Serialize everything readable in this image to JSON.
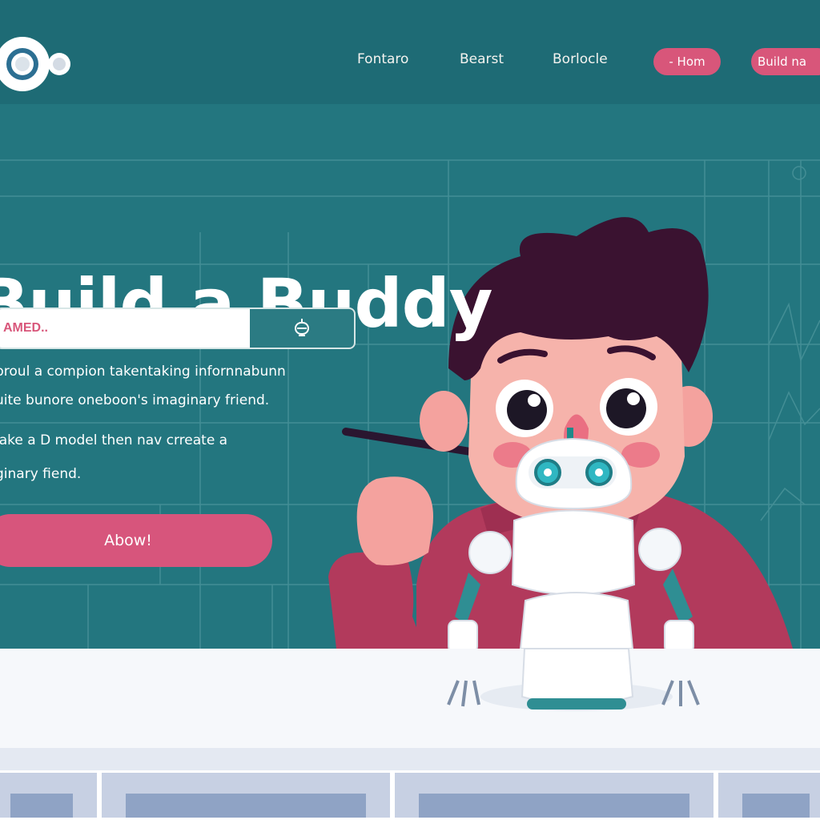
{
  "header": {
    "nav": [
      "Fontaro",
      "Bearst",
      "Borlocle"
    ],
    "home_label": "- Hom",
    "build_label": "Build na"
  },
  "hero": {
    "title": "Build a Buddy",
    "search": {
      "placeholder": "AMED.."
    },
    "paragraphs": [
      "proul a compion takentaking infornnabunn",
      "uite bunore oneboon's imaginary friend.",
      "lake a D model then nav crreate a",
      "ginary fiend."
    ],
    "cta_label": "Abow!"
  },
  "colors": {
    "accent": "#d8567a",
    "background": "#23767f",
    "header": "#1e6b75"
  },
  "icons": [
    "logo-icon",
    "robot-head-icon"
  ]
}
